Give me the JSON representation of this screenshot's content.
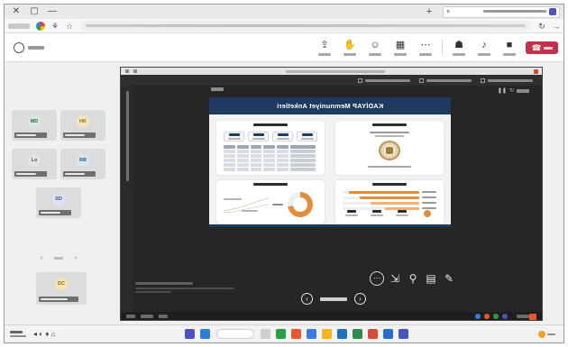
{
  "window": {
    "title_icons": [
      "close-icon",
      "maximize-icon",
      "minimize-icon"
    ],
    "new_tab_glyph": "+",
    "tab_close_glyph": "×"
  },
  "toolbar": {
    "leave_glyph": "☎"
  },
  "presentation": {
    "slide_title": "KADİYAP Memnuniyet Anketleri"
  },
  "slide_nav": {
    "prev_glyph": "‹",
    "next_glyph": "›"
  },
  "participants": {
    "tiles": [
      {
        "initials": "HK",
        "bg": "#f3e6bf",
        "fg": "#8c6d1f"
      },
      {
        "initials": "MD",
        "bg": "#d6ebdd",
        "fg": "#2f6b45"
      },
      {
        "initials": "RB",
        "bg": "#d8e6f5",
        "fg": "#2d5a8c"
      },
      {
        "initials": "Lo",
        "bg": "#e4e4e4",
        "fg": "#555555"
      },
      {
        "initials": "SD",
        "bg": "#dde3f6",
        "fg": "#3a4f9a"
      },
      {
        "initials": "DC",
        "bg": "#f6e4b5",
        "fg": "#8a6a18"
      }
    ],
    "pager": {
      "prev": "‹",
      "next": "›"
    }
  },
  "chart_data": {
    "type": "donut",
    "values": [
      72,
      28
    ],
    "colors": [
      "#e38d3a",
      "#eeeeee"
    ]
  },
  "bars_data": {
    "type": "bar",
    "orientation": "horizontal",
    "values": [
      0.92,
      0.78,
      0.64,
      0.45
    ],
    "colors": [
      "#e38d3a",
      "#e38d3a",
      "#f0b27a",
      "#f0b27a"
    ]
  },
  "theme": {
    "header_navy": "#1f3a5f",
    "leave_red": "#c4314b",
    "teams_purple": "#4b53bc",
    "accent_orange": "#e38d3a"
  }
}
